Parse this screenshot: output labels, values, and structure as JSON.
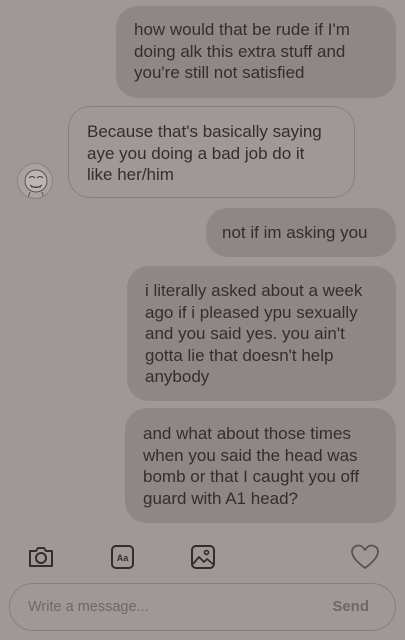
{
  "messages": [
    {
      "direction": "sent",
      "text": "how would  that be rude if I'm\ndoing alk this extra stuff and\nyou're  still not satisfied"
    },
    {
      "direction": "received",
      "text": "Because that's basically saying\naye you doing a bad job do it\nlike her/him"
    },
    {
      "direction": "sent",
      "text": "not if im asking you"
    },
    {
      "direction": "sent",
      "text": "i literally asked about a week\nago if i pleased ypu sexually\nand you said yes. you ain't\ngotta lie that doesn't  help\nanybody"
    },
    {
      "direction": "sent",
      "text": "and what about those times\nwhen you said the head was\nbomb or that I caught you off\nguard with A1 head?"
    }
  ],
  "toolbar": {
    "icons": [
      "camera-icon",
      "text-format-icon",
      "image-icon",
      "heart-icon"
    ],
    "text_format_glyph": "Aa"
  },
  "composer": {
    "placeholder": "Write a message...",
    "send_label": "Send"
  },
  "colors": {
    "background": "#a09898",
    "sent_bubble": "#8f8787",
    "received_border": "#877f7f",
    "text": "#332e2e",
    "muted_text": "#6e6767"
  }
}
